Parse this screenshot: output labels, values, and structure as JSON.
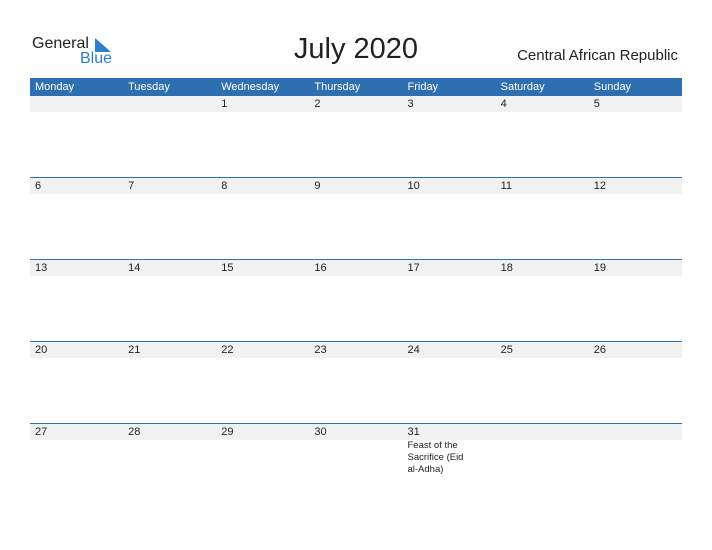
{
  "logo": {
    "word1": "General",
    "word2": "Blue"
  },
  "title": "July 2020",
  "country": "Central African Republic",
  "colors": {
    "accent": "#2e6fb0",
    "row_bg": "#f1f1f1",
    "logo_blue": "#2a7fd4"
  },
  "weekdays": [
    "Monday",
    "Tuesday",
    "Wednesday",
    "Thursday",
    "Friday",
    "Saturday",
    "Sunday"
  ],
  "weeks": [
    {
      "days": [
        "",
        "",
        "1",
        "2",
        "3",
        "4",
        "5"
      ],
      "events": [
        "",
        "",
        "",
        "",
        "",
        "",
        ""
      ]
    },
    {
      "days": [
        "6",
        "7",
        "8",
        "9",
        "10",
        "11",
        "12"
      ],
      "events": [
        "",
        "",
        "",
        "",
        "",
        "",
        ""
      ]
    },
    {
      "days": [
        "13",
        "14",
        "15",
        "16",
        "17",
        "18",
        "19"
      ],
      "events": [
        "",
        "",
        "",
        "",
        "",
        "",
        ""
      ]
    },
    {
      "days": [
        "20",
        "21",
        "22",
        "23",
        "24",
        "25",
        "26"
      ],
      "events": [
        "",
        "",
        "",
        "",
        "",
        "",
        ""
      ]
    },
    {
      "days": [
        "27",
        "28",
        "29",
        "30",
        "31",
        "",
        ""
      ],
      "events": [
        "",
        "",
        "",
        "",
        "Feast of the Sacrifice (Eid al-Adha)",
        "",
        ""
      ]
    }
  ]
}
